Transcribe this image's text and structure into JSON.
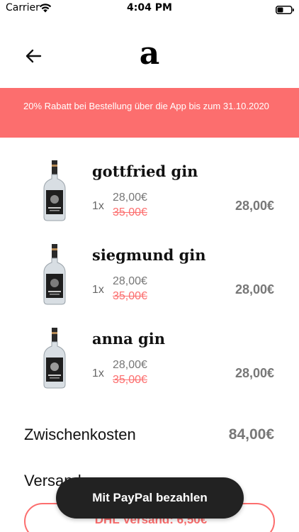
{
  "status_bar": {
    "carrier": "Carrier",
    "time": "4:04 PM",
    "icons": [
      "wifi-icon",
      "battery-icon"
    ]
  },
  "nav": {
    "back_icon": "arrow-left-icon",
    "logo": "a"
  },
  "promo": {
    "text": "20% Rabatt bei Bestellung über die App bis zum 31.10.2020",
    "background": "#fc6e6e"
  },
  "cart": {
    "items": [
      {
        "name": "gottfried gin",
        "quantity": "1x",
        "price": "28,00€",
        "old_price": "35,00€",
        "total": "28,00€"
      },
      {
        "name": "siegmund gin",
        "quantity": "1x",
        "price": "28,00€",
        "old_price": "35,00€",
        "total": "28,00€"
      },
      {
        "name": "anna gin",
        "quantity": "1x",
        "price": "28,00€",
        "old_price": "35,00€",
        "total": "28,00€"
      }
    ]
  },
  "summary": {
    "subtotal_label": "Zwischenkosten",
    "subtotal_value": "84,00€",
    "shipping_label": "Versand",
    "shipping_option": "DHL Versand: 6,50€"
  },
  "checkout": {
    "paypal_label": "Mit PayPal bezahlen"
  },
  "colors": {
    "accent": "#fc6e6e",
    "button_dark": "#222222",
    "muted_text": "#777777"
  }
}
